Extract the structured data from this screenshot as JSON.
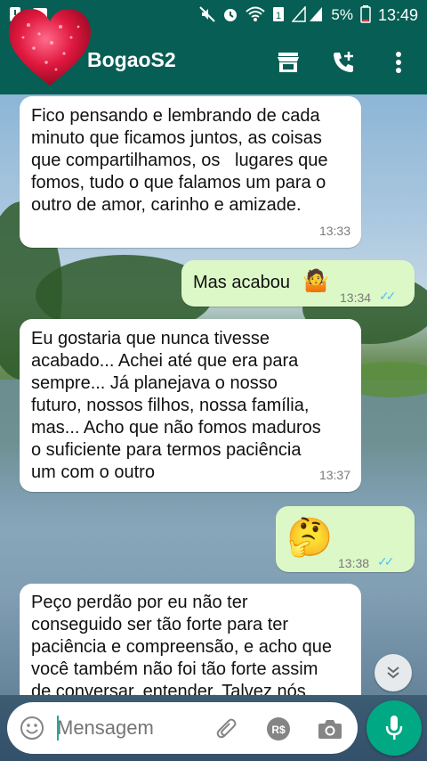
{
  "status_bar": {
    "battery_percent": "5%",
    "time": "13:49",
    "icons": [
      "notification-icon",
      "image-icon",
      "mute-icon",
      "alarm-icon",
      "wifi-icon",
      "sim-icon",
      "signal-icon",
      "battery-icon"
    ]
  },
  "header": {
    "title": "BogaoS2",
    "icons": [
      "store-icon",
      "add-call-icon",
      "more-vert-icon"
    ]
  },
  "messages": [
    {
      "direction": "in",
      "text": "Fico pensando e lembrando de cada\nminuto que ficamos juntos, as coisas\nque compartilhamos, os   lugares que\nfomos, tudo o que falamos um para o\noutro de amor, carinho e amizade.",
      "time": "13:33"
    },
    {
      "direction": "out",
      "text": "Mas acabou",
      "emoji": "🤷",
      "time": "13:34",
      "read": true
    },
    {
      "direction": "in",
      "text": "Eu gostaria que nunca tivesse\nacabado... Achei até que era para\nsempre... Já planejava o nosso\nfuturo, nossos filhos, nossa família,\nmas... Acho que não fomos maduros\no suficiente para termos paciência\num com o outro",
      "time": "13:37"
    },
    {
      "direction": "out",
      "text": "",
      "emoji": "🤔",
      "time": "13:38",
      "read": true
    },
    {
      "direction": "in",
      "text": "Peço perdão por eu não ter\nconseguido ser tão forte para ter\npaciência e compreensão, e acho que\nvocê também não foi tão forte assim\nde conversar, entender. Talvez nós",
      "time": ""
    }
  ],
  "input": {
    "placeholder": "Mensagem",
    "icons": [
      "emoji-icon",
      "attach-icon",
      "payment-icon",
      "camera-icon",
      "mic-icon"
    ]
  },
  "colors": {
    "header": "#075e54",
    "outgoing_bubble": "#dcf8c6",
    "incoming_bubble": "#ffffff",
    "read_ticks": "#4fc3f7",
    "mic_button": "#00a884"
  }
}
